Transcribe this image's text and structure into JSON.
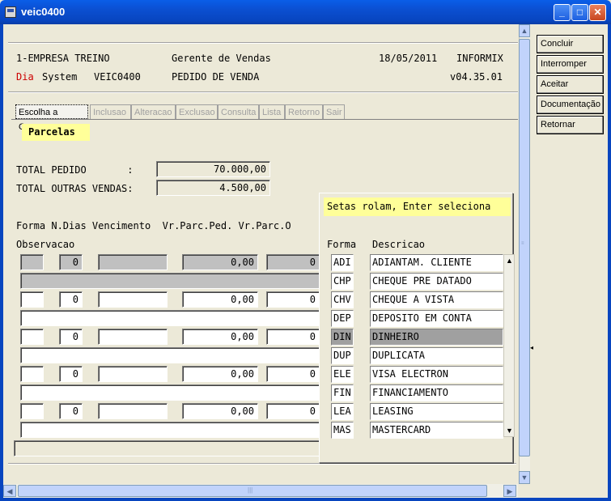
{
  "window": {
    "title": "veic0400",
    "minimize_glyph": "_",
    "maximize_glyph": "□",
    "close_glyph": "✕"
  },
  "header": {
    "company": "1-EMPRESA TREINO",
    "role": "Gerente de Vendas",
    "date": "18/05/2011",
    "db": "INFORMIX",
    "day_label": "Dia",
    "system_label": "System",
    "program": "VEIC0400",
    "screen": "PEDIDO DE VENDA",
    "version": "v04.35.01"
  },
  "tabs": [
    {
      "label": "Escolha a Opcao",
      "enabled": true
    },
    {
      "label": "Inclusao",
      "enabled": false
    },
    {
      "label": "Alteracao",
      "enabled": false
    },
    {
      "label": "Exclusao",
      "enabled": false
    },
    {
      "label": "Consulta",
      "enabled": false
    },
    {
      "label": "Lista",
      "enabled": false
    },
    {
      "label": "Retorno",
      "enabled": false
    },
    {
      "label": "Sair",
      "enabled": false
    }
  ],
  "section_title": "Parcelas",
  "totals": {
    "pedido_label": "TOTAL PEDIDO       :",
    "pedido_value": "70.000,00",
    "outras_label": "TOTAL OUTRAS VENDAS:",
    "outras_value": "4.500,00"
  },
  "grid": {
    "headers": "Forma N.Dias Vencimento  Vr.Parc.Ped. Vr.Parc.O",
    "obs_label": "Observacao",
    "rows": [
      {
        "dias": "0",
        "valor": "0,00",
        "trunc": "0"
      },
      {
        "dias": "0",
        "valor": "0,00",
        "trunc": "0"
      },
      {
        "dias": "0",
        "valor": "0,00",
        "trunc": "0"
      },
      {
        "dias": "0",
        "valor": "0,00",
        "trunc": "0"
      },
      {
        "dias": "0",
        "valor": "0,00",
        "trunc": "0"
      }
    ]
  },
  "popup": {
    "hint": "Setas rolam, Enter seleciona",
    "col_forma": "Forma",
    "col_desc": "Descricao",
    "items": [
      {
        "code": "ADI",
        "desc": "ADIANTAM. CLIENTE"
      },
      {
        "code": "CHP",
        "desc": "CHEQUE PRE DATADO"
      },
      {
        "code": "CHV",
        "desc": "CHEQUE A VISTA"
      },
      {
        "code": "DEP",
        "desc": "DEPOSITO EM CONTA"
      },
      {
        "code": "DIN",
        "desc": "DINHEIRO"
      },
      {
        "code": "DUP",
        "desc": "DUPLICATA"
      },
      {
        "code": "ELE",
        "desc": "VISA ELECTRON"
      },
      {
        "code": "FIN",
        "desc": "FINANCIAMENTO"
      },
      {
        "code": "LEA",
        "desc": "LEASING"
      },
      {
        "code": "MAS",
        "desc": "MASTERCARD"
      }
    ],
    "selected_index": 4
  },
  "actions": {
    "concluir": "Concluir",
    "interromper": "Interromper",
    "aceitar": "Aceitar",
    "documentacao": "Documentação",
    "retornar": "Retornar"
  },
  "scroll": {
    "up": "▲",
    "down": "▼",
    "left": "◀",
    "right": "▶",
    "grip": "|||"
  },
  "colors": {
    "titlebar": "#0845bf",
    "highlight_yellow": "#ffff99",
    "selected_row": "#a0a0a0",
    "day_label_red": "#cc0000"
  }
}
